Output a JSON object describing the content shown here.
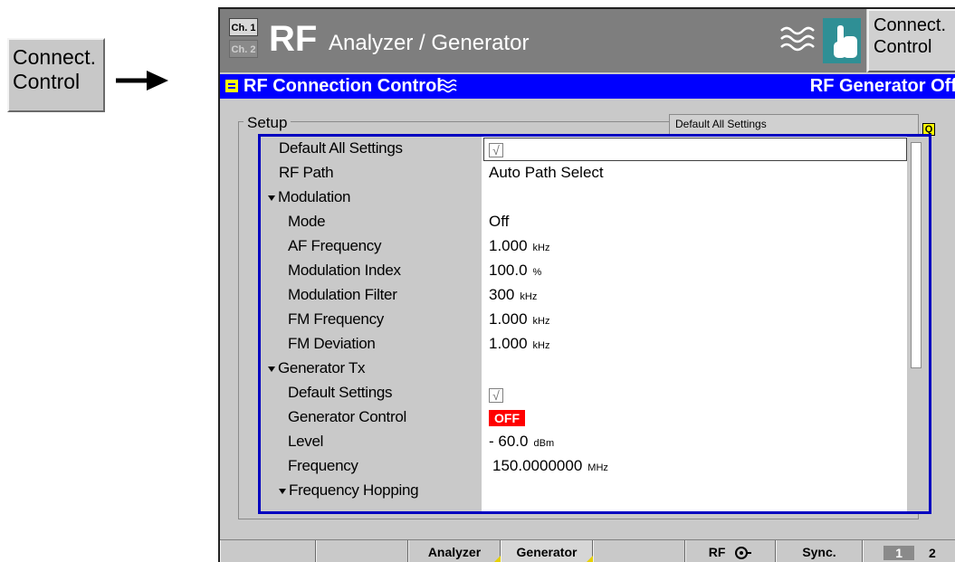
{
  "side_softkey": {
    "line1": "Connect.",
    "line2": "Control"
  },
  "header": {
    "ch1": "Ch. 1",
    "ch2": "Ch. 2",
    "title_main": "RF",
    "title_sub": "Analyzer / Generator",
    "softkey_line1": "Connect.",
    "softkey_line2": "Control"
  },
  "panel": {
    "title": "RF Connection Control",
    "status": "RF Generator Off"
  },
  "setup": {
    "group_label": "Setup",
    "default_button": "Default All Settings"
  },
  "rows": [
    {
      "label": "Default All Settings",
      "value": "",
      "checkbox": true
    },
    {
      "label": "RF Path",
      "value": "Auto Path Select"
    },
    {
      "label": "Modulation",
      "value": "",
      "section": true
    },
    {
      "label": "Mode",
      "value": "Off"
    },
    {
      "label": "AF Frequency",
      "value": "1.000",
      "unit": "kHz"
    },
    {
      "label": "Modulation Index",
      "value": "100.0",
      "unit": "%"
    },
    {
      "label": "Modulation Filter",
      "value": "300",
      "unit": "kHz"
    },
    {
      "label": "FM Frequency",
      "value": "1.000",
      "unit": "kHz"
    },
    {
      "label": "FM Deviation",
      "value": "1.000",
      "unit": "kHz"
    },
    {
      "label": "Generator Tx",
      "value": "",
      "section": true
    },
    {
      "label": "Default Settings",
      "value": "",
      "checkbox": true
    },
    {
      "label": "Generator Control",
      "value": "OFF",
      "badge": true
    },
    {
      "label": "Level",
      "value": "- 60.0",
      "unit": "dBm"
    },
    {
      "label": "Frequency",
      "value": "150.0000000",
      "unit": "MHz"
    },
    {
      "label": "Frequency Hopping",
      "value": "",
      "section": true
    }
  ],
  "bottom_softkeys": {
    "analyzer": "Analyzer",
    "generator": "Generator",
    "rf": "RF",
    "sync": "Sync.",
    "page1": "1",
    "page2": "2"
  },
  "icons": {
    "checkbox_glyph": "√",
    "quick_icon": "Q"
  },
  "colors": {
    "title_bar": "#7e7e7e",
    "panel_bar": "#0000ff",
    "accent_teal": "#2f8f95",
    "badge_red": "#ff0000",
    "highlight_yellow": "#ffff00"
  }
}
